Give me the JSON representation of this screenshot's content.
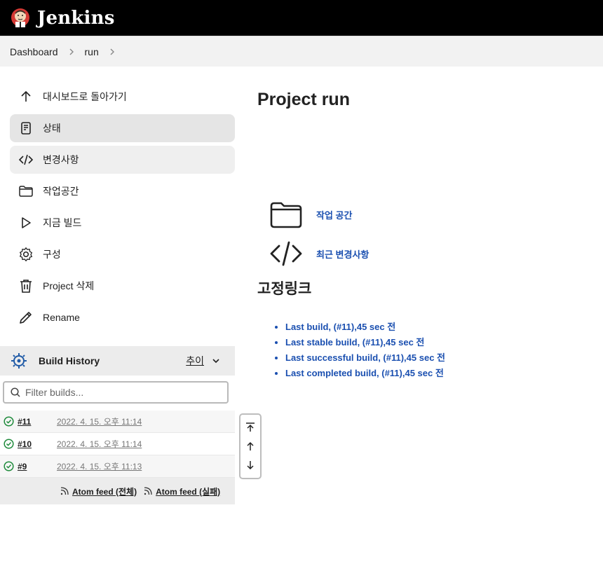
{
  "header": {
    "brand": "Jenkins"
  },
  "breadcrumb": {
    "items": [
      "Dashboard",
      "run"
    ]
  },
  "sidebar": {
    "tasks": [
      {
        "label": "대시보드로 돌아가기",
        "icon": "arrow-up-icon"
      },
      {
        "label": "상태",
        "icon": "document-icon"
      },
      {
        "label": "변경사항",
        "icon": "code-icon"
      },
      {
        "label": "작업공간",
        "icon": "folder-icon"
      },
      {
        "label": "지금 빌드",
        "icon": "play-icon"
      },
      {
        "label": "구성",
        "icon": "gear-icon"
      },
      {
        "label": "Project 삭제",
        "icon": "trash-icon"
      },
      {
        "label": "Rename",
        "icon": "pencil-icon"
      }
    ]
  },
  "build_history": {
    "title": "Build History",
    "trend_label": "추이",
    "filter_placeholder": "Filter builds...",
    "builds": [
      {
        "number": "#11",
        "date": "2022. 4. 15. 오후 11:14",
        "status": "success"
      },
      {
        "number": "#10",
        "date": "2022. 4. 15. 오후 11:14",
        "status": "success"
      },
      {
        "number": "#9",
        "date": "2022. 4. 15. 오후 11:13",
        "status": "success"
      }
    ],
    "feeds": {
      "all": "Atom feed (전체)",
      "failed": "Atom feed (실패)"
    }
  },
  "main": {
    "title": "Project run",
    "links": [
      {
        "label": "작업 공간",
        "icon": "folder-icon"
      },
      {
        "label": "최근 변경사항",
        "icon": "code-icon"
      }
    ],
    "permalinks_title": "고정링크",
    "permalinks": [
      "Last build, (#11),45 sec 전",
      "Last stable build, (#11),45 sec 전",
      "Last successful build, (#11),45 sec 전",
      "Last completed build, (#11),45 sec 전"
    ]
  },
  "colors": {
    "link": "#1a4fb0",
    "success": "#1e8a3b",
    "header_bg": "#000000",
    "active_task_bg": "#e5e5e5"
  }
}
